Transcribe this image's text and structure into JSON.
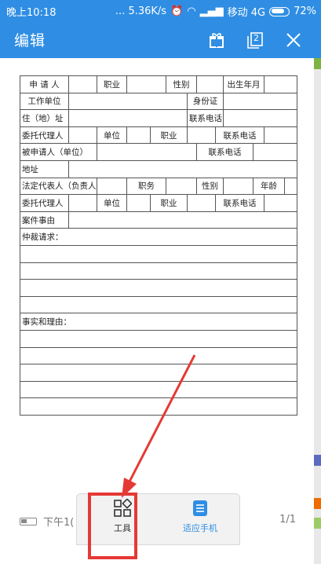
{
  "status": {
    "time": "晚上10:18",
    "network": "... 5.36K/s",
    "carrier": "移动 4G",
    "battery": "72%"
  },
  "appbar": {
    "title": "编辑",
    "page_count_icon": "2"
  },
  "form": {
    "r1": [
      "申 请 人",
      "职业",
      "性别",
      "出生年月"
    ],
    "r2": [
      "工作单位",
      "身份证"
    ],
    "r3": [
      "住（地）址",
      "联系电话"
    ],
    "r4": [
      "委托代理人",
      "单位",
      "职业",
      "联系电话"
    ],
    "r5": [
      "被申请人（单位）",
      "联系电话"
    ],
    "r6": [
      "地址"
    ],
    "r7": [
      "法定代表人（负责人）",
      "职务",
      "性别",
      "年龄"
    ],
    "r8": [
      "委托代理人",
      "单位",
      "职业",
      "联系电话"
    ],
    "r9": [
      "案件事由"
    ],
    "claims_label": "仲裁请求：",
    "facts_label": "事实和理由："
  },
  "footer": {
    "time_partial": "下午1(",
    "page": "1/1"
  },
  "toolbar": {
    "tools_label": "工具",
    "fit_label": "适应手机"
  },
  "colors": {
    "primary": "#2f8ee3",
    "highlight": "#e53935"
  },
  "icons": [
    "gift-icon",
    "page-count-icon",
    "close-icon",
    "tools-grid-icon",
    "fit-phone-icon"
  ]
}
